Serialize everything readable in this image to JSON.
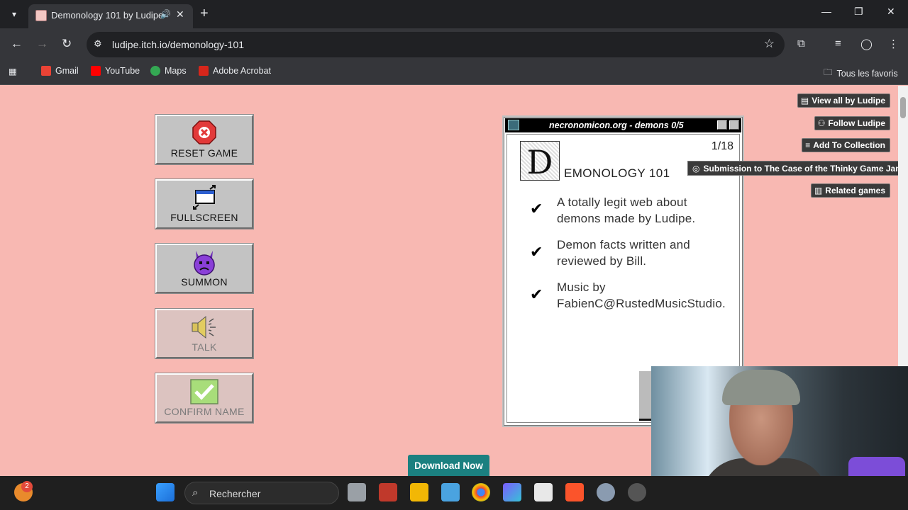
{
  "browser": {
    "tab_title": "Demonology 101 by Ludipe",
    "url": "ludipe.itch.io/demonology-101",
    "bookmarks": [
      "Gmail",
      "YouTube",
      "Maps",
      "Adobe Acrobat"
    ],
    "all_bookmarks_label": "Tous les favoris"
  },
  "game_buttons": {
    "reset": "RESET GAME",
    "fullscreen": "FULLSCREEN",
    "summon": "SUMMON",
    "talk": "TALK",
    "confirm": "CONFIRM NAME"
  },
  "window": {
    "title": "necronomicon.org  -  demons 0/5",
    "page_counter": "1/18",
    "drop_cap": "D",
    "heading": "EMONOLOGY 101",
    "items": [
      {
        "line1": "A totally legit web about",
        "line2": "demons made by Ludipe."
      },
      {
        "line1": "Demon facts written and",
        "line2": "reviewed by Bill."
      },
      {
        "line1": "Music by",
        "line2": "FabienC@RustedMusicStudio."
      }
    ]
  },
  "itch_sidebar": {
    "view_all": "View all by Ludipe",
    "follow": "Follow Ludipe",
    "add_collection": "Add To Collection",
    "submission": "Submission to The Case of the Thinky Game Jam",
    "related": "Related games"
  },
  "download_label": "Download Now",
  "taskbar": {
    "search_placeholder": "Rechercher",
    "weather_badge": "2"
  },
  "colors": {
    "page_bg": "#f8b8b2",
    "window_title_bg": "#000000",
    "download_bg": "#1b8080"
  }
}
